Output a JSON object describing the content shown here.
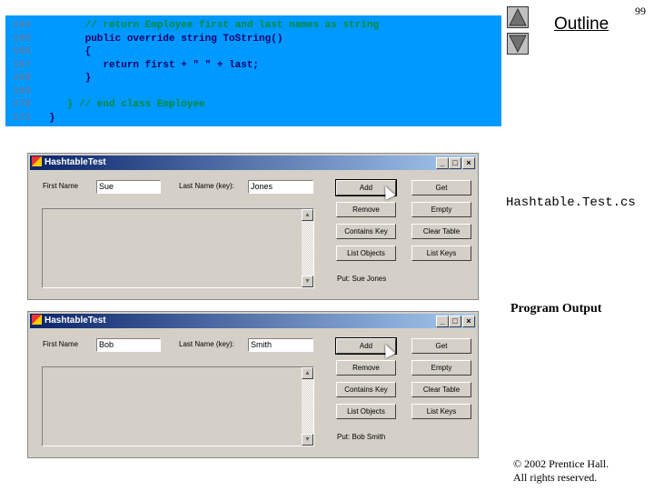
{
  "code": {
    "lines": [
      {
        "num": "164",
        "text": "      // return Employee first and last names as string",
        "comment": true
      },
      {
        "num": "165",
        "text": "      public override string ToString()",
        "comment": false
      },
      {
        "num": "166",
        "text": "      {",
        "comment": false
      },
      {
        "num": "167",
        "text": "         return first + \" \" + last;",
        "comment": false
      },
      {
        "num": "168",
        "text": "      }",
        "comment": false
      },
      {
        "num": "169",
        "text": "",
        "comment": false
      },
      {
        "num": "170",
        "text": "   } // end class Employee",
        "comment": true
      },
      {
        "num": "171",
        "text": "}",
        "comment": false
      }
    ]
  },
  "nav": {
    "outline": "Outline",
    "page": "99",
    "up_icon": "triangle-up",
    "down_icon": "triangle-down"
  },
  "file_name": "Hashtable.Test.cs",
  "program_output": "Program Output",
  "copyright": {
    "line1": "© 2002 Prentice Hall.",
    "line2": "All rights reserved."
  },
  "windows": [
    {
      "title": "HashtableTest",
      "first_label": "First Name",
      "last_label": "Last Name (key):",
      "first_value": "Sue",
      "last_value": "Jones",
      "buttons": [
        "Add",
        "Get",
        "Remove",
        "Empty",
        "Contains Key",
        "Clear Table",
        "List Objects",
        "List Keys"
      ],
      "status": "Put: Sue Jones"
    },
    {
      "title": "HashtableTest",
      "first_label": "First Name",
      "last_label": "Last Name (key):",
      "first_value": "Bob",
      "last_value": "Smith",
      "buttons": [
        "Add",
        "Get",
        "Remove",
        "Empty",
        "Contains Key",
        "Clear Table",
        "List Objects",
        "List Keys"
      ],
      "status": "Put: Bob Smith"
    }
  ],
  "colors": {
    "code_bg": "#0099ff",
    "comment": "#008a3a",
    "window_bg": "#d4d0c8"
  }
}
